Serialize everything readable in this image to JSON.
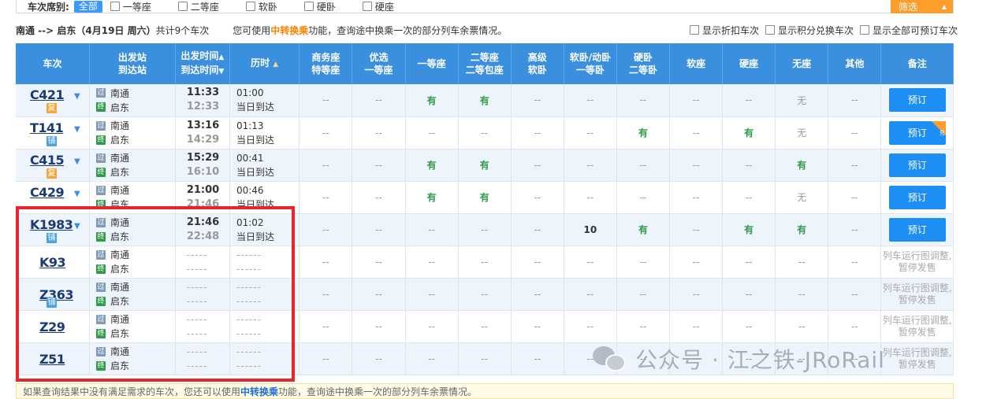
{
  "filter": {
    "title": "车次席别:",
    "all_label": "全部",
    "seat_options": [
      "一等座",
      "二等座",
      "软卧",
      "硬卧",
      "硬座"
    ],
    "filter_button": "筛选"
  },
  "summary": {
    "route": "南通 --> 启东（4月19日 周六）",
    "count": "共计9个车次",
    "tip_prefix": "您可使用",
    "tip_link": "中转换乘",
    "tip_suffix": "功能，查询途中换乘一次的部分列车余票情况。",
    "options": [
      "显示折扣车次",
      "显示积分兑换车次",
      "显示全部可预订车次"
    ]
  },
  "headers": {
    "train": "车次",
    "station_1": "出发站",
    "station_2": "到达站",
    "time_1": "出发时间",
    "time_2": "到达时间",
    "duration": "历时",
    "business_1": "商务座",
    "business_2": "特等座",
    "premium_1": "优选",
    "premium_2": "一等座",
    "first": "一等座",
    "second_1": "二等座",
    "second_2": "二等包座",
    "deluxe_1": "高级",
    "deluxe_2": "软卧",
    "soft_sleeper_1": "软卧/动卧",
    "soft_sleeper_2": "一等卧",
    "hard_sleeper_1": "硬卧",
    "hard_sleeper_2": "二等卧",
    "soft_seat": "软座",
    "hard_seat": "硬座",
    "no_seat": "无座",
    "other": "其他",
    "remark": "备注"
  },
  "trains": [
    {
      "no": "C421",
      "badge": "复",
      "from": "南通",
      "to": "启东",
      "dep": "11:33",
      "arr": "12:33",
      "dur": "01:00",
      "arrive_day": "当日到达",
      "seats": [
        "--",
        "--",
        "有",
        "有",
        "--",
        "--",
        "--",
        "--",
        "--",
        "无",
        "--"
      ],
      "action": "预订"
    },
    {
      "no": "T141",
      "badge": "铺",
      "from": "南通",
      "to": "启东",
      "dep": "13:16",
      "arr": "14:29",
      "dur": "01:13",
      "arrive_day": "当日到达",
      "seats": [
        "--",
        "--",
        "--",
        "--",
        "--",
        "--",
        "有",
        "--",
        "有",
        "无",
        "--"
      ],
      "action": "预订",
      "corner": "兑"
    },
    {
      "no": "C415",
      "badge": "复",
      "from": "南通",
      "to": "启东",
      "dep": "15:29",
      "arr": "16:10",
      "dur": "00:41",
      "arrive_day": "当日到达",
      "seats": [
        "--",
        "--",
        "有",
        "有",
        "--",
        "--",
        "--",
        "--",
        "--",
        "有",
        "--"
      ],
      "action": "预订"
    },
    {
      "no": "C429",
      "badge": "",
      "from": "南通",
      "to": "启东",
      "dep": "21:00",
      "arr": "21:46",
      "dur": "00:46",
      "arrive_day": "当日到达",
      "seats": [
        "--",
        "--",
        "有",
        "有",
        "--",
        "--",
        "--",
        "--",
        "--",
        "无",
        "--"
      ],
      "action": "预订"
    },
    {
      "no": "K1983",
      "badge": "铺",
      "from": "南通",
      "to": "启东",
      "dep": "21:46",
      "arr": "22:48",
      "dur": "01:02",
      "arrive_day": "当日到达",
      "seats": [
        "--",
        "--",
        "--",
        "--",
        "--",
        "10",
        "有",
        "--",
        "有",
        "有",
        "--"
      ],
      "action": "预订"
    },
    {
      "no": "K93",
      "badge": "",
      "from": "南通",
      "to": "启东",
      "dep": "-----",
      "arr": "-----",
      "dur": "------",
      "arrive_day": "------",
      "seats": [
        "--",
        "--",
        "--",
        "--",
        "--",
        "--",
        "--",
        "--",
        "--",
        "--",
        "--"
      ],
      "remark": "列车运行图调整,暂停发售"
    },
    {
      "no": "Z363",
      "badge": "铺",
      "from": "南通",
      "to": "启东",
      "dep": "-----",
      "arr": "-----",
      "dur": "------",
      "arrive_day": "------",
      "seats": [
        "--",
        "--",
        "--",
        "--",
        "--",
        "--",
        "--",
        "--",
        "--",
        "--",
        "--"
      ],
      "remark": "列车运行图调整,暂停发售"
    },
    {
      "no": "Z29",
      "badge": "",
      "from": "南通",
      "to": "启东",
      "dep": "-----",
      "arr": "-----",
      "dur": "------",
      "arrive_day": "------",
      "seats": [
        "--",
        "--",
        "--",
        "--",
        "--",
        "--",
        "--",
        "--",
        "--",
        "--",
        "--"
      ],
      "remark": "列车运行图调整,暂停发售"
    },
    {
      "no": "Z51",
      "badge": "",
      "from": "南通",
      "to": "启东",
      "dep": "-----",
      "arr": "-----",
      "dur": "------",
      "arrive_day": "------",
      "seats": [
        "--",
        "--",
        "--",
        "--",
        "--",
        "--",
        "--",
        "--",
        "--",
        "--",
        "--"
      ],
      "remark": "列车运行图调整,暂停发售"
    }
  ],
  "bottom_note": {
    "prefix": "如果查询结果中没有满足需求的车次，您还可以使用",
    "link": "中转换乘",
    "suffix": "功能，查询途中换乘一次的部分列车余票情况。"
  },
  "watermark": "公众号 · 江之铁-JRoRail"
}
